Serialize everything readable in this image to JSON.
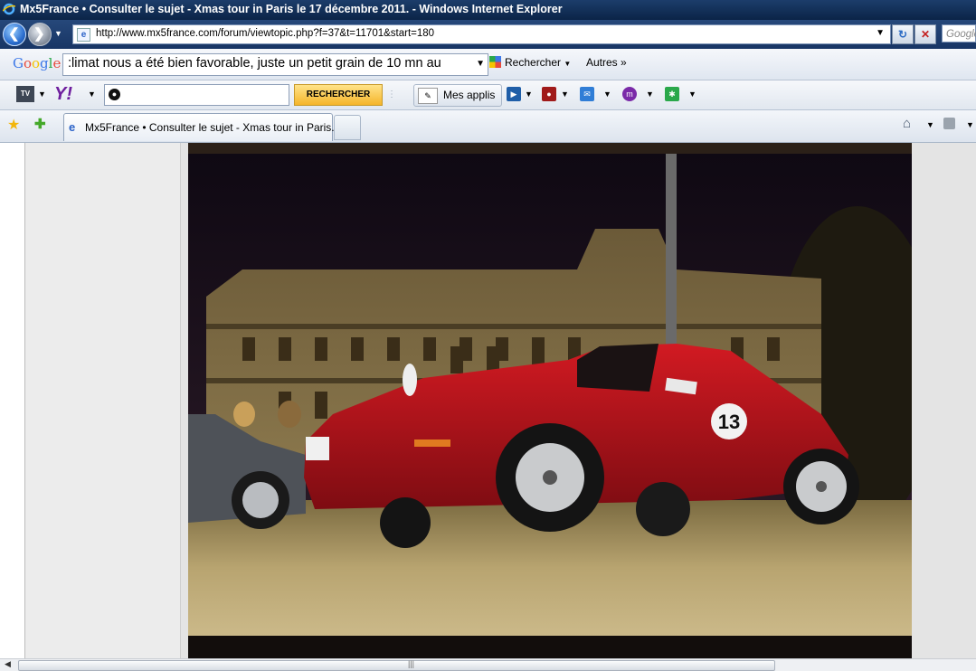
{
  "window": {
    "title": "Mx5France • Consulter le sujet - Xmas tour in Paris le 17 décembre 2011. - Windows Internet Explorer"
  },
  "address_bar": {
    "url": "http://www.mx5france.com/forum/viewtopic.php?f=37&t=11701&start=180",
    "search_placeholder": "Google"
  },
  "google_toolbar": {
    "logo": "Google",
    "search_value": ":limat nous a été bien favorable, juste un petit grain de 10 mn au",
    "search_button": "Rechercher",
    "more_button": "Autres »"
  },
  "yahoo_toolbar": {
    "tv_label": "TV",
    "logo": "Y!",
    "search_button": "RECHERCHER",
    "apps_button": "Mes applis"
  },
  "tabs": {
    "items": [
      {
        "label": "Mx5France • Consulter le sujet - Xmas tour in Paris..."
      }
    ]
  },
  "photo": {
    "subject": "red roadster at night in Paris",
    "race_number": "13"
  },
  "colors": {
    "titlebar": "#1c3d6b",
    "car_red": "#b5141c",
    "yahoo_purple": "#6e1e9e",
    "search_button": "#f5b52a"
  }
}
